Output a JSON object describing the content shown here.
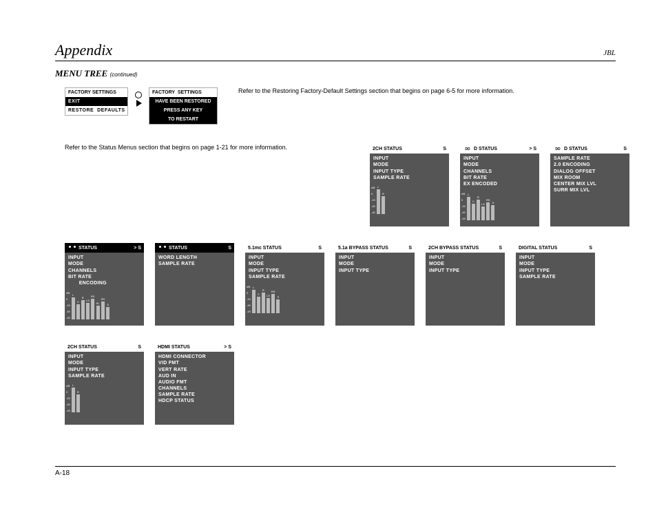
{
  "header": {
    "title": "Appendix",
    "brand": "JBL"
  },
  "section": {
    "title": "MENU TREE",
    "continued": "(continued)"
  },
  "factory_menu": {
    "title": "FACTORY SETTINGS",
    "items": [
      "EXIT",
      "RESTORE  DEFAULTS"
    ],
    "selected_index": 1
  },
  "factory_msg": {
    "title": "FACTORY  SETTINGS",
    "lines": [
      "HAVE  BEEN  RESTORED",
      "PRESS  ANY  KEY",
      "TO  RESTART"
    ]
  },
  "note_factory": "Refer to the Restoring Factory-Default Settings section that begins on page 6-5 for more information.",
  "note_status": "Refer to the Status Menus section that begins on page 1-21 for more information.",
  "footer": {
    "page": "A-18"
  },
  "scale": {
    "top": "dB",
    "labels": [
      "0",
      "-15",
      "-30",
      "-45"
    ]
  },
  "cards": {
    "r1": [
      {
        "title": "2CH STATUS",
        "suffix": "S",
        "icon": "",
        "lines": [
          "INPUT",
          "MODE",
          "INPUT TYPE",
          "SAMPLE RATE"
        ],
        "meters": [
          "L",
          "R"
        ],
        "heights": [
          36,
          26
        ]
      },
      {
        "title": "D STATUS",
        "suffix": ">  S",
        "icon": "dd",
        "lines": [
          "INPUT",
          "MODE",
          "CHANNELS",
          "BIT RATE",
          "EX ENCODED"
        ],
        "meters": [
          "L",
          "C",
          "R",
          "LS",
          "RS",
          "S"
        ],
        "heights": [
          34,
          24,
          30,
          20,
          26,
          22
        ]
      },
      {
        "title": "D STATUS",
        "suffix": "S",
        "icon": "dd",
        "lines": [
          "SAMPLE RATE",
          "2.0 ENCODING",
          "DIALOG OFFSET",
          "MIX ROOM",
          "CENTER MIX LVL",
          "SURR MIX LVL"
        ],
        "meters": null
      }
    ],
    "r2": [
      {
        "title": "STATUS",
        "suffix": ">  S",
        "icon": "dts",
        "lines": [
          "INPUT",
          "MODE",
          "CHANNELS",
          "BIT RATE",
          "       ENCODING"
        ],
        "meters": [
          "L",
          "C",
          "R",
          "LS",
          "RS",
          "SL",
          "SR",
          "S"
        ],
        "heights": [
          32,
          22,
          28,
          24,
          30,
          20,
          26,
          18
        ]
      },
      {
        "title": "STATUS",
        "suffix": "S",
        "icon": "dts",
        "lines": [
          "WORD LENGTH",
          "SAMPLE RATE"
        ],
        "meters": null
      },
      {
        "title": "5.1mc STATUS",
        "suffix": "S",
        "icon": "",
        "lines": [
          "INPUT",
          "MODE",
          "INPUT TYPE",
          "SAMPLE RATE"
        ],
        "meters": [
          "L",
          "C",
          "R",
          "LS",
          "RS",
          "S"
        ],
        "heights": [
          34,
          24,
          30,
          22,
          28,
          20
        ]
      },
      {
        "title": "5.1a BYPASS STATUS",
        "suffix": "S",
        "icon": "",
        "lines": [
          "INPUT",
          "MODE",
          "INPUT TYPE"
        ],
        "meters": null
      },
      {
        "title": "2CH BYPASS STATUS",
        "suffix": "S",
        "icon": "",
        "lines": [
          "INPUT",
          "MODE",
          "INPUT TYPE"
        ],
        "meters": null
      },
      {
        "title": "DIGITAL STATUS",
        "suffix": "S",
        "icon": "",
        "lines": [
          "INPUT",
          "MODE",
          "INPUT TYPE",
          "SAMPLE RATE"
        ],
        "meters": null
      }
    ],
    "r3": [
      {
        "title": "2CH STATUS",
        "suffix": "S",
        "icon": "",
        "lines": [
          "INPUT",
          "MODE",
          "INPUT TYPE",
          "SAMPLE RATE"
        ],
        "meters": [
          "L",
          "R"
        ],
        "heights": [
          36,
          26
        ]
      },
      {
        "title": "HDMI STATUS",
        "suffix": ">  S",
        "icon": "",
        "lines": [
          "HDMI CONNECTOR",
          "VID FMT",
          "VERT RATE",
          "AUD IN",
          "AUDIO FMT",
          "CHANNELS",
          "SAMPLE RATE",
          "HDCP STATUS"
        ],
        "meters": null
      }
    ]
  }
}
